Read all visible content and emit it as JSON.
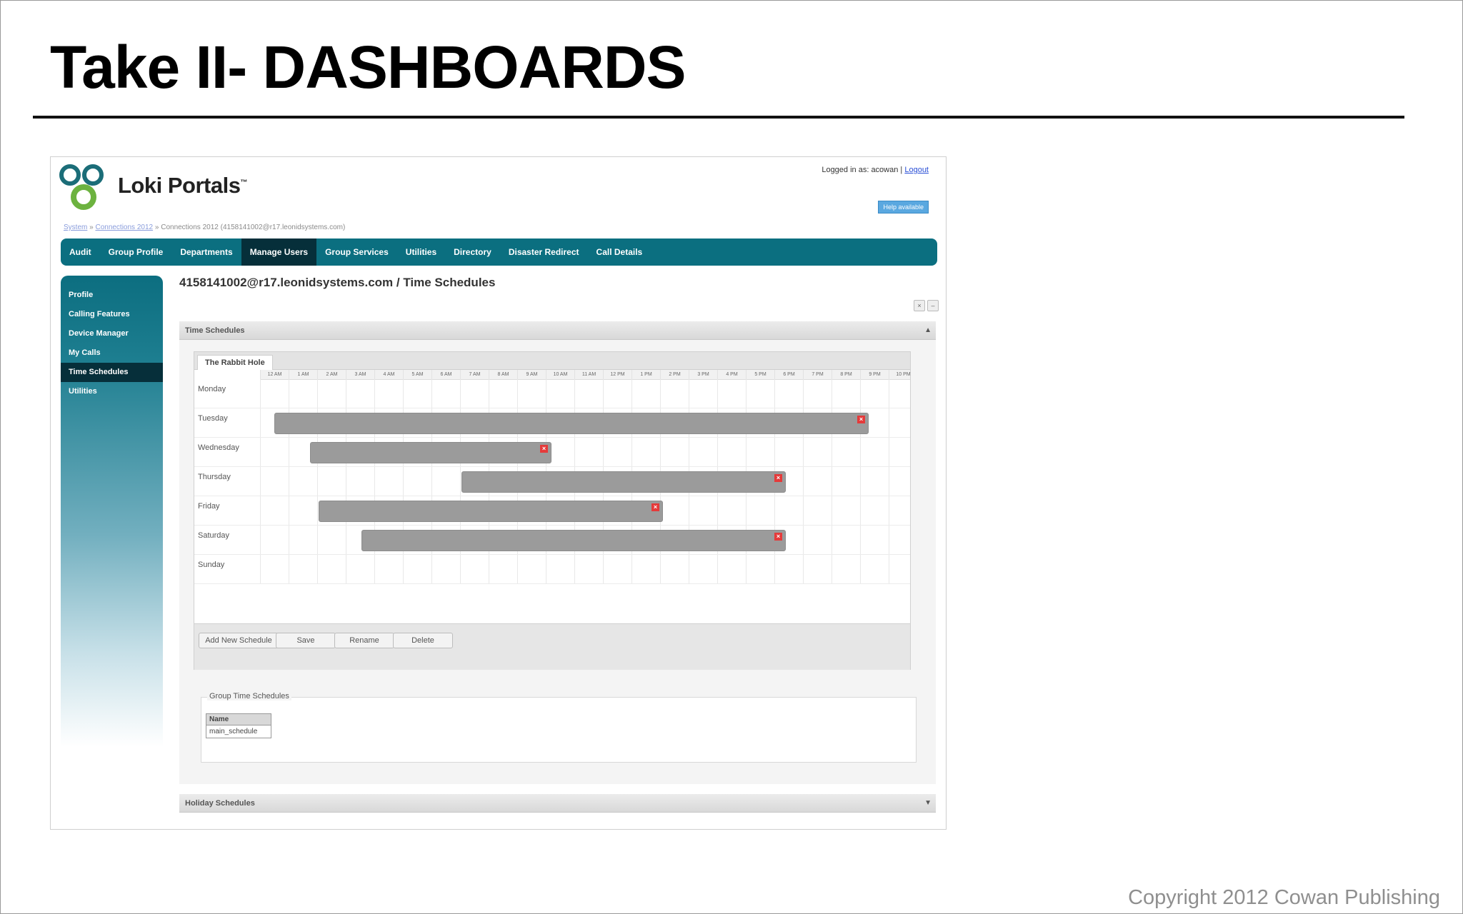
{
  "slide": {
    "title": "Take II- DASHBOARDS",
    "copyright": "Copyright 2012 Cowan Publishing"
  },
  "portal": {
    "brand": "Loki Portals",
    "brand_mark": "™",
    "logged_in_label": "Logged in as: acowan |",
    "logout_link": "Logout",
    "help_button": "Help available",
    "breadcrumb": {
      "link1": "System",
      "sep1": "»",
      "link2": "Connections 2012",
      "sep2": "»",
      "current": "Connections 2012 (4158141002@r17.leonidsystems.com)"
    },
    "nav": [
      "Audit",
      "Group Profile",
      "Departments",
      "Manage Users",
      "Group Services",
      "Utilities",
      "Directory",
      "Disaster Redirect",
      "Call Details"
    ],
    "nav_active_index": 3,
    "sidebar": [
      "Profile",
      "Calling Features",
      "Device Manager",
      "My Calls",
      "Time Schedules",
      "Utilities"
    ],
    "sidebar_active_index": 4,
    "page_heading": "4158141002@r17.leonidsystems.com / Time Schedules",
    "time_schedules_panel": "Time Schedules",
    "holiday_schedules_panel": "Holiday Schedules",
    "schedule_tab": "The Rabbit Hole",
    "hours": [
      "12 AM",
      "1 AM",
      "2 AM",
      "3 AM",
      "4 AM",
      "5 AM",
      "6 AM",
      "7 AM",
      "8 AM",
      "9 AM",
      "10 AM",
      "11 AM",
      "12 PM",
      "1 PM",
      "2 PM",
      "3 PM",
      "4 PM",
      "5 PM",
      "6 PM",
      "7 PM",
      "8 PM",
      "9 PM",
      "10 PM"
    ],
    "days": [
      "Monday",
      "Tuesday",
      "Wednesday",
      "Thursday",
      "Friday",
      "Saturday",
      "Sunday"
    ],
    "schedule_bars": [
      {
        "day": "Tuesday",
        "start_hour": 0.5,
        "end_hour": 21.3
      },
      {
        "day": "Wednesday",
        "start_hour": 1.75,
        "end_hour": 10.2
      },
      {
        "day": "Thursday",
        "start_hour": 7.05,
        "end_hour": 18.4
      },
      {
        "day": "Friday",
        "start_hour": 2.05,
        "end_hour": 14.1
      },
      {
        "day": "Saturday",
        "start_hour": 3.55,
        "end_hour": 18.4
      }
    ],
    "buttons": {
      "add_new": "Add New Schedule",
      "save": "Save",
      "rename": "Rename",
      "delete": "Delete"
    },
    "group_time_schedules": {
      "legend": "Group Time Schedules",
      "column": "Name",
      "rows": [
        "main_schedule"
      ]
    },
    "icons": {
      "delete": "close-icon",
      "collapse": "chevron-up-icon",
      "expand": "chevron-down-icon"
    },
    "colors": {
      "nav": "#0b6f80",
      "nav_active": "#062f3a",
      "bar": "#9b9b9b",
      "delete_icon": "#e53a3a"
    }
  }
}
